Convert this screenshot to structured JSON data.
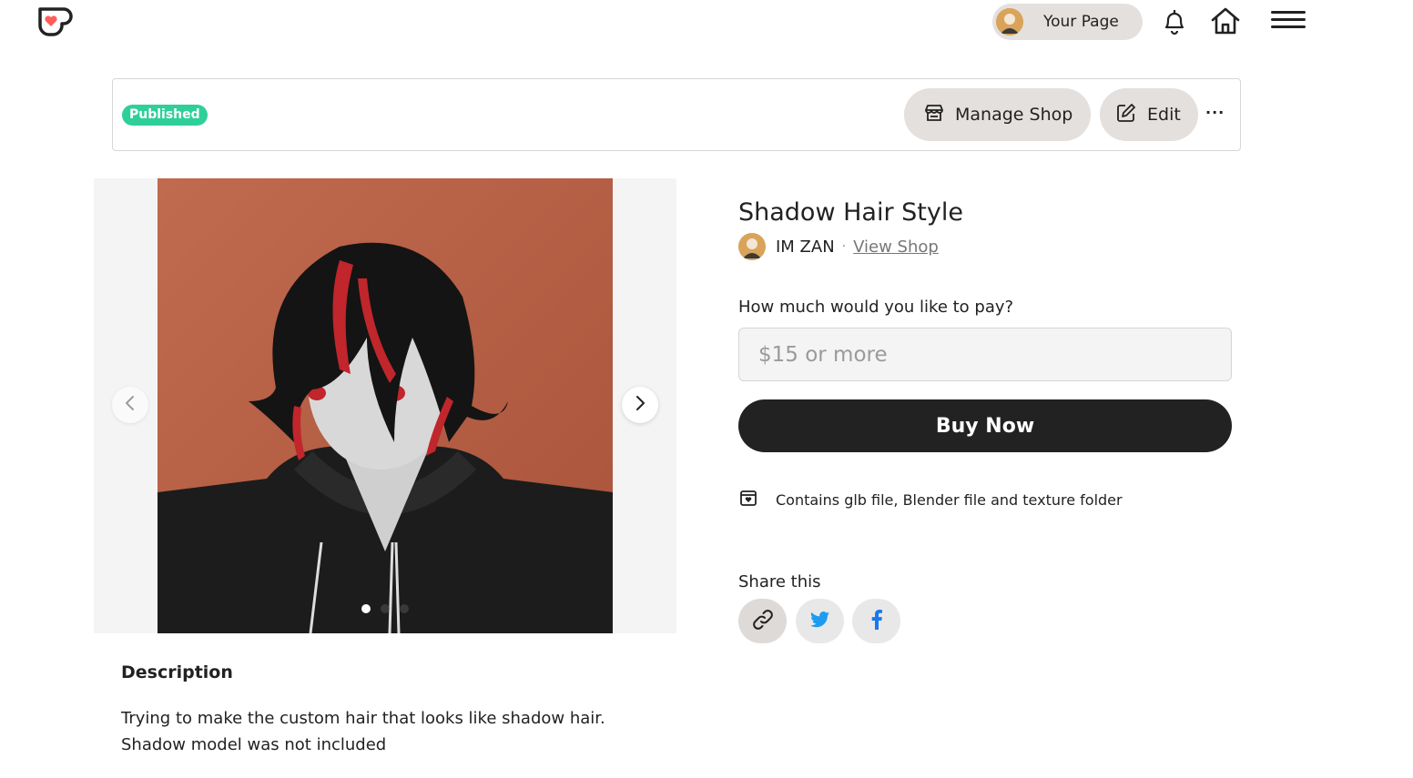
{
  "nav": {
    "your_page_label": "Your Page"
  },
  "status_bar": {
    "badge": "Published",
    "manage_shop_label": "Manage Shop",
    "edit_label": "Edit",
    "more_label": "···"
  },
  "product": {
    "title": "Shadow Hair Style",
    "creator_name": "IM ZAN",
    "separator": "·",
    "view_shop_label": "View Shop",
    "pay_label": "How much would you like to pay?",
    "pay_placeholder": "$15 or more",
    "buy_now_label": "Buy Now",
    "contains_text": "Contains glb file, Blender file and texture folder",
    "share_label": "Share this"
  },
  "gallery": {
    "slide_count": 3,
    "active_slide": 1,
    "image_background": "#b85f45"
  },
  "description": {
    "title": "Description",
    "line1": "Trying to make the custom hair that looks like shadow hair.",
    "line2": "Shadow model was not included"
  },
  "colors": {
    "brand": "#ff5e5b",
    "badge": "#2fcf9a",
    "button_pill": "#e4e0dd",
    "buy_now": "#222222",
    "twitter": "#1d9bf0",
    "facebook": "#1877f2"
  },
  "icons": [
    "kofi-logo-icon",
    "bell-icon",
    "home-icon",
    "hamburger-menu-icon",
    "shop-icon",
    "edit-icon",
    "more-icon",
    "chevron-left-icon",
    "chevron-right-icon",
    "package-icon",
    "link-icon",
    "twitter-icon",
    "facebook-icon"
  ]
}
